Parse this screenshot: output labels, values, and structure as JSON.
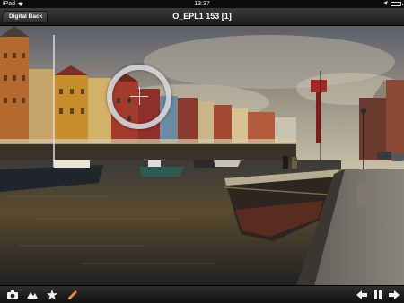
{
  "status_bar": {
    "carrier": "iPad",
    "time": "13:37",
    "battery_percent": 75
  },
  "nav_bar": {
    "back_label": "Digital Back",
    "title": "O_EPL1 153 [1]"
  },
  "toolbar": {
    "left_icons": [
      "camera-icon",
      "mountain-icon",
      "star-icon",
      "pencil-icon"
    ],
    "right_icons": [
      "previous-arrow-icon",
      "pause-icon",
      "next-arrow-icon"
    ],
    "accent_pencil": "#e8902a"
  },
  "icons": {
    "wifi": "wifi-icon",
    "location": "location-arrow-icon",
    "battery": "battery-icon",
    "zoom_ring": "zoom-loupe-icon"
  }
}
